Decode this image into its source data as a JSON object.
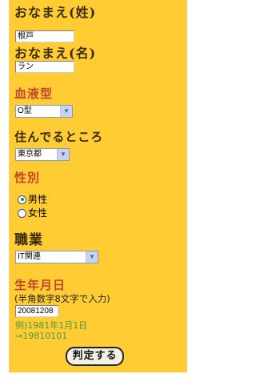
{
  "form": {
    "last_name_label": "おなまえ(姓)",
    "last_name_value": "根戸",
    "first_name_label": "おなまえ(名)",
    "first_name_value": "ラン",
    "blood_type_label": "血液型",
    "blood_type_value": "O型",
    "residence_label": "住んでるところ",
    "residence_value": "東京都",
    "gender_label": "性別",
    "gender_options": [
      "男性",
      "女性"
    ],
    "gender_selected": "男性",
    "job_label": "職業",
    "job_value": "IT関連",
    "birthday_label": "生年月日",
    "birthday_hint": "(半角数字8文字で入力)",
    "birthday_value": "20081208",
    "example_line1": "例)1981年1月1日",
    "example_line2": "⇒19810101",
    "submit_label": "判定する"
  },
  "colors": {
    "background": "#ffcc33",
    "label_dark": "#3a2c0a",
    "label_red": "#c2452e",
    "example_green": "#4a9a44"
  }
}
